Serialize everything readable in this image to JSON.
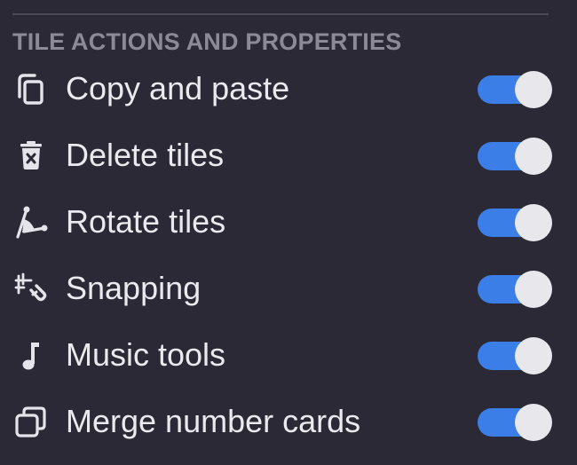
{
  "section": {
    "title": "TILE ACTIONS AND PROPERTIES"
  },
  "colors": {
    "background": "#2a2935",
    "accent": "#3c7ee8",
    "section_title": "#8b8a95"
  },
  "items": [
    {
      "label": "Copy and paste",
      "icon": "copy-icon",
      "enabled": true
    },
    {
      "label": "Delete tiles",
      "icon": "trash-icon",
      "enabled": true
    },
    {
      "label": "Rotate tiles",
      "icon": "rotate-angle-icon",
      "enabled": true
    },
    {
      "label": "Snapping",
      "icon": "snap-magnet-icon",
      "enabled": true
    },
    {
      "label": "Music tools",
      "icon": "music-note-icon",
      "enabled": true
    },
    {
      "label": "Merge number cards",
      "icon": "merge-cards-icon",
      "enabled": true
    }
  ]
}
